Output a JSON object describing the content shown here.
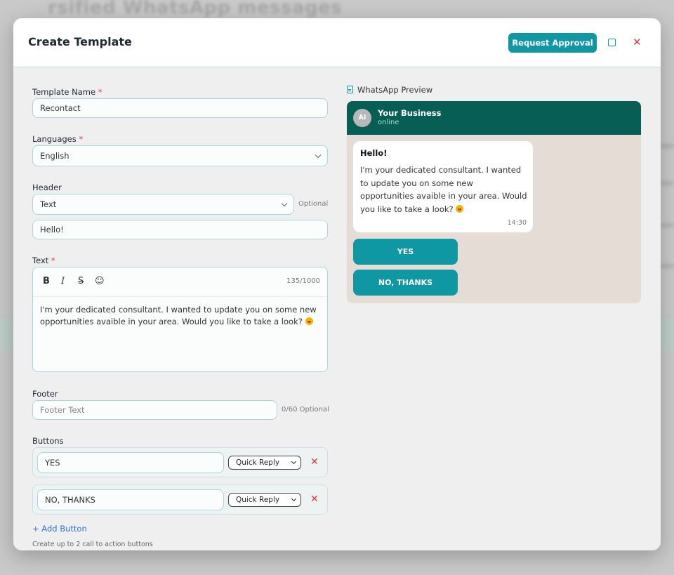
{
  "modal": {
    "title": "Create Template",
    "request_approval_label": "Request Approval"
  },
  "form": {
    "template_name": {
      "label": "Template Name",
      "value": "Recontact"
    },
    "languages": {
      "label": "Languages",
      "value": "English"
    },
    "header": {
      "label": "Header",
      "type_value": "Text",
      "optional": "Optional",
      "text_value": "Hello!"
    },
    "text": {
      "label": "Text",
      "counter": "135/1000",
      "value": "I'm your dedicated consultant. I wanted to update you on some new opportunities avaible in your area. Would you like to take a look?"
    },
    "footer": {
      "label": "Footer",
      "placeholder": "Footer Text",
      "counter": "0/60 Optional"
    },
    "buttons": {
      "label": "Buttons",
      "items": [
        {
          "value": "YES",
          "type": "Quick Reply"
        },
        {
          "value": "NO, THANKS",
          "type": "Quick Reply"
        }
      ],
      "add_label": "+ Add Button",
      "hint": "Create up to 2 call to action buttons"
    }
  },
  "preview": {
    "label": "WhatsApp Preview",
    "avatar": "AI",
    "business_name": "Your Business",
    "status": "online",
    "message_header": "Hello!",
    "message_text": "I'm your dedicated consultant. I wanted to update you on some new opportunities avaible in your area. Would you like to take a look?",
    "time": "14:30",
    "buttons": [
      "YES",
      "NO, THANKS"
    ]
  },
  "colors": {
    "accent": "#0f97a3",
    "wa_header": "#075e54",
    "wa_bg": "#e5ddd5",
    "danger": "#e53935"
  }
}
